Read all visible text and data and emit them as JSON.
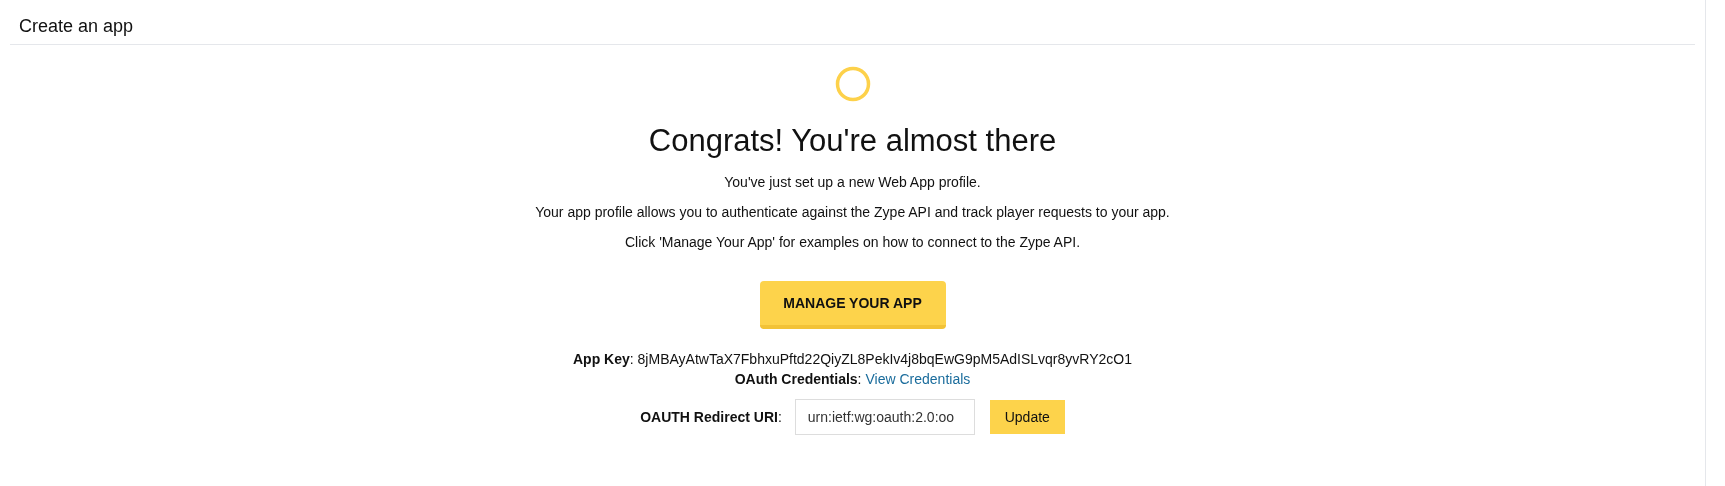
{
  "page_title": "Create an app",
  "heading": "Congrats! You're almost there",
  "paragraphs": [
    "You've just set up a new Web App profile.",
    "Your app profile allows you to authenticate against the Zype API and track player requests to your app.",
    "Click 'Manage Your App' for examples on how to connect to the Zype API."
  ],
  "manage_button": "MANAGE YOUR APP",
  "app_key": "**App Key**: 8jMBAyAtwTaX7FbhxuPftd22QiyZL8PekIv4j8bqEwG9pM5AdISLvqr8yvRY2cO1",
  "oauth_credentials": {
    "label": "**OAuth Credentials**:",
    "link": "View Credentials"
  },
  "redirect_uri": {
    "label": "**OAUTH Redirect URI**:",
    "value": "urn:ietf:wg:oauth:2.0:oo",
    "button": "Update"
  }
}
